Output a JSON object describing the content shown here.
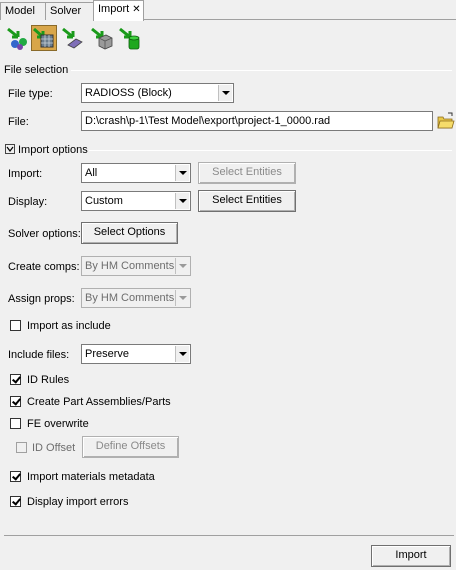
{
  "tabs": [
    {
      "label": "Model"
    },
    {
      "label": "Solver"
    },
    {
      "label": "Import",
      "close": "✕"
    }
  ],
  "toolbar": {
    "icons": [
      "import-model-icon",
      "import-geometry-icon",
      "import-solver-deck-icon",
      "import-fe-icon",
      "import-connectors-icon"
    ]
  },
  "file_selection": {
    "section_title": "File selection",
    "file_type_label": "File type:",
    "file_type_value": "RADIOSS (Block)",
    "file_label": "File:",
    "file_value": "D:\\crash\\p-1\\Test Model\\export\\project-1_0000.rad"
  },
  "import_options": {
    "section_title": "Import options",
    "import_label": "Import:",
    "import_value": "All",
    "import_select_entities": "Select Entities",
    "display_label": "Display:",
    "display_value": "Custom",
    "display_select_entities": "Select Entities",
    "solver_options_label": "Solver options:",
    "solver_options_button": "Select Options",
    "create_comps_label": "Create comps:",
    "create_comps_value": "By HM Comments",
    "assign_props_label": "Assign props:",
    "assign_props_value": "By HM Comments",
    "import_as_include": "Import as include",
    "include_files_label": "Include files:",
    "include_files_value": "Preserve",
    "id_rules": "ID Rules",
    "create_part_assemblies": "Create Part Assemblies/Parts",
    "fe_overwrite": "FE overwrite",
    "id_offset": "ID Offset",
    "define_offsets": "Define Offsets",
    "import_materials_metadata": "Import materials metadata",
    "display_import_errors": "Display import errors"
  },
  "footer": {
    "import_button": "Import"
  }
}
